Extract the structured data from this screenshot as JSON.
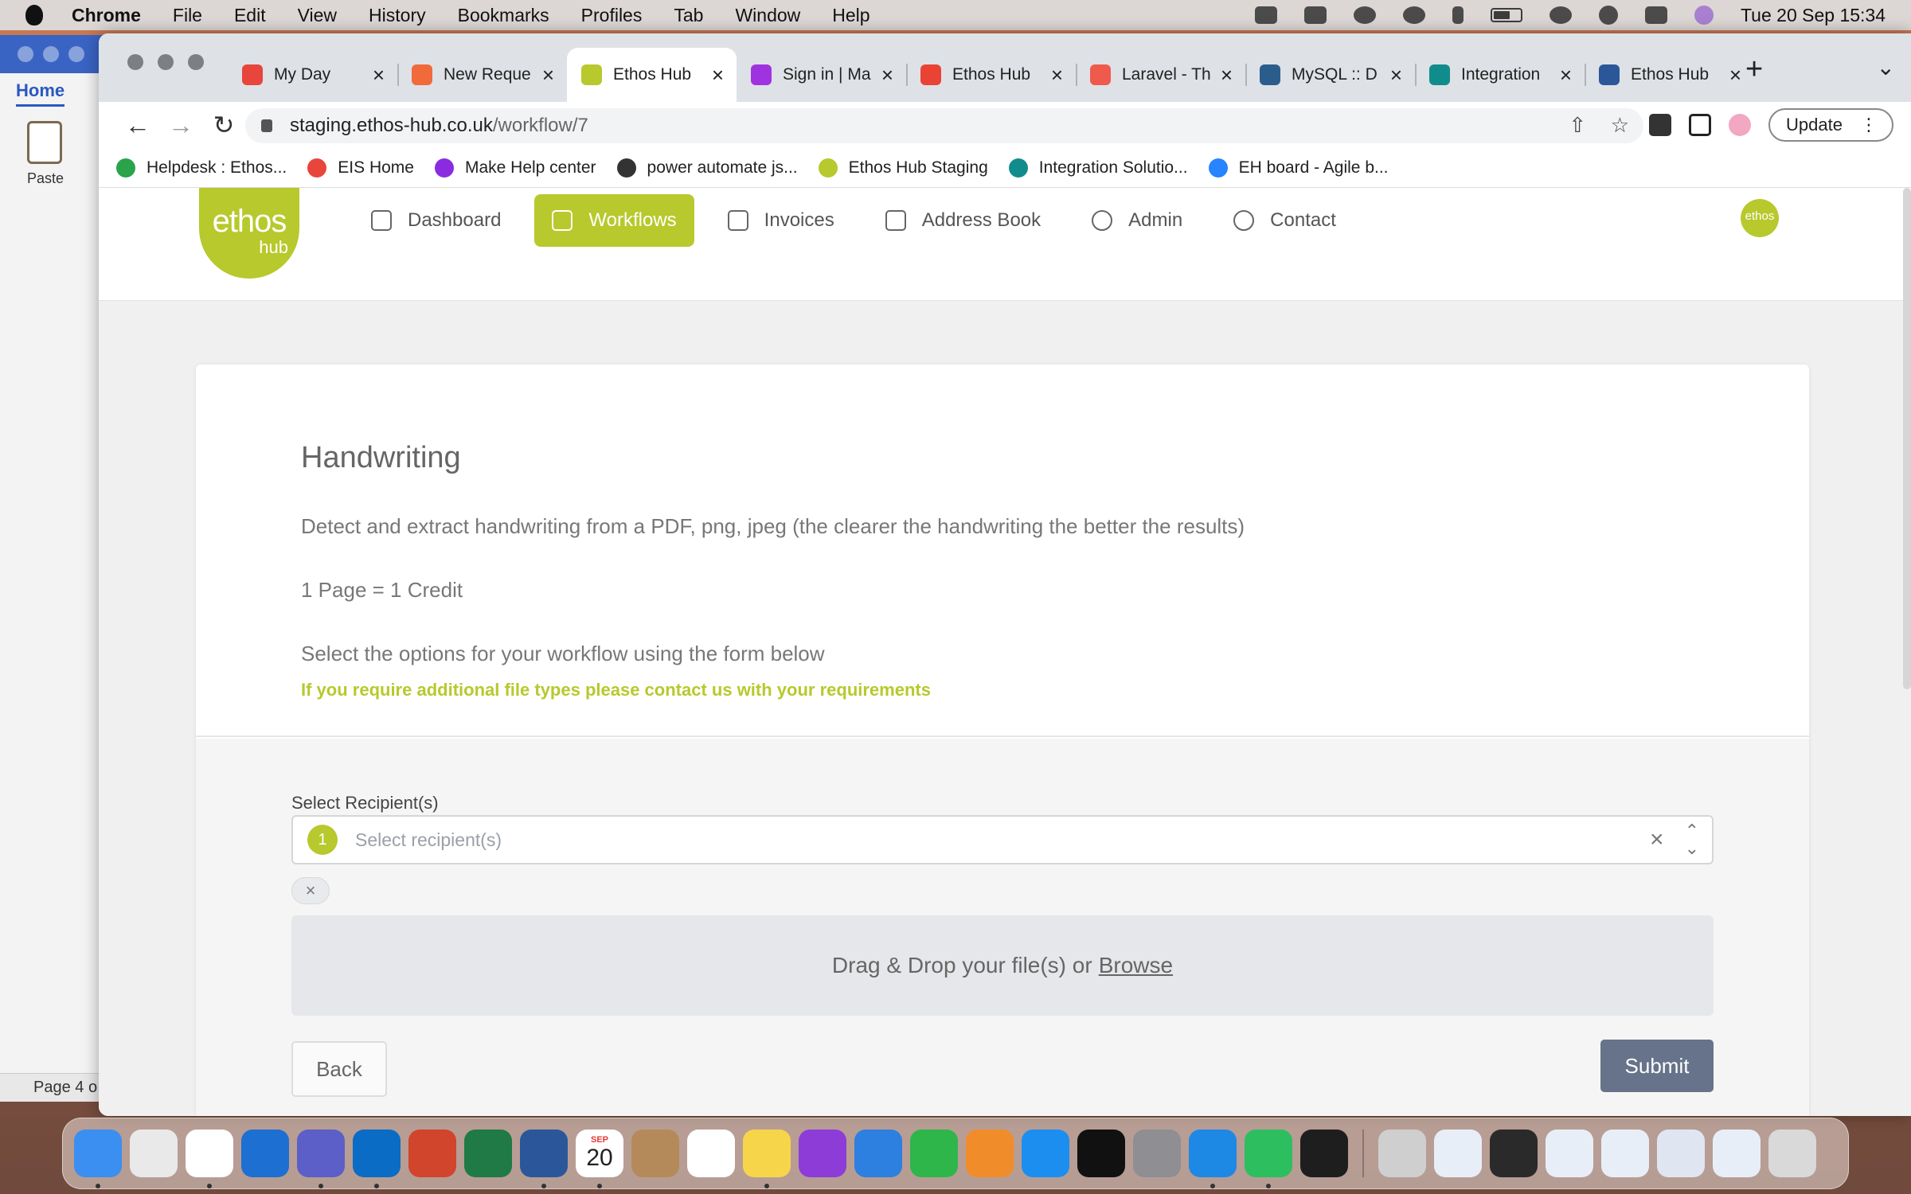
{
  "menubar": {
    "app_name": "Chrome",
    "items": [
      "File",
      "Edit",
      "View",
      "History",
      "Bookmarks",
      "Profiles",
      "Tab",
      "Window",
      "Help"
    ],
    "datetime": "Tue 20 Sep  15:34"
  },
  "word": {
    "tab_home": "Home",
    "paste_label": "Paste",
    "status": "Page 4 o"
  },
  "browser": {
    "tabs": [
      {
        "title": "My Day",
        "favicon_color": "#e8453c"
      },
      {
        "title": "New Reque",
        "favicon_color": "#f06a3a"
      },
      {
        "title": "Ethos Hub",
        "favicon_color": "#b7c92c"
      },
      {
        "title": "Sign in | Ma",
        "favicon_color": "#a033e0"
      },
      {
        "title": "Ethos Hub",
        "favicon_color": "#ea4335"
      },
      {
        "title": "Laravel - Th",
        "favicon_color": "#ef5a4c"
      },
      {
        "title": "MySQL :: D",
        "favicon_color": "#2b5d8c"
      },
      {
        "title": "Integration",
        "favicon_color": "#118c8c"
      },
      {
        "title": "Ethos Hub",
        "favicon_color": "#2b579a"
      }
    ],
    "active_tab_index": 2,
    "url_host": "staging.ethos-hub.co.uk",
    "url_path": "/workflow/7",
    "update_label": "Update",
    "bookmarks": [
      {
        "label": "Helpdesk : Ethos...",
        "color": "#2aa34a"
      },
      {
        "label": "EIS Home",
        "color": "#e8453c"
      },
      {
        "label": "Make Help center",
        "color": "#8a2be2"
      },
      {
        "label": "power automate js...",
        "color": "#333333"
      },
      {
        "label": "Ethos Hub Staging",
        "color": "#b7c92c"
      },
      {
        "label": "Integration Solutio...",
        "color": "#118c8c"
      },
      {
        "label": "EH board - Agile b...",
        "color": "#2684ff"
      }
    ]
  },
  "app": {
    "logo_text": "ethos",
    "logo_subtext": "hub",
    "avatar_text": "ethos",
    "accent_color": "#b7c92c",
    "nav": [
      {
        "label": "Dashboard",
        "icon": "bar-chart-icon",
        "active": false
      },
      {
        "label": "Workflows",
        "icon": "cube-icon",
        "active": true
      },
      {
        "label": "Invoices",
        "icon": "invoice-icon",
        "active": false
      },
      {
        "label": "Address Book",
        "icon": "book-icon",
        "active": false
      },
      {
        "label": "Admin",
        "icon": "gear-icon",
        "active": false
      },
      {
        "label": "Contact",
        "icon": "lifebuoy-icon",
        "active": false
      }
    ]
  },
  "workflow": {
    "title": "Handwriting",
    "description": "Detect and extract handwriting from a PDF, png, jpeg (the clearer the handwriting the better the results)",
    "credit": "1 Page = 1 Credit",
    "instructions": "Select the options for your workflow using the form below",
    "note": "If you require additional file types please contact us with your requirements",
    "recipient_label": "Select Recipient(s)",
    "recipient_count": "1",
    "recipient_placeholder": "Select recipient(s)",
    "dropzone_text": "Drag & Drop your file(s) or",
    "browse_label": "Browse",
    "back_label": "Back",
    "submit_label": "Submit"
  },
  "dock": {
    "calendar_month": "SEP",
    "calendar_day": "20",
    "apps": [
      {
        "name": "finder-icon",
        "color": "#3b8ff0"
      },
      {
        "name": "launchpad-icon",
        "color": "#e9e9e9"
      },
      {
        "name": "chrome-icon",
        "color": "#ffffff"
      },
      {
        "name": "onedrive-icon",
        "color": "#1d6fd1"
      },
      {
        "name": "teams-icon",
        "color": "#5b5fc7"
      },
      {
        "name": "outlook-icon",
        "color": "#0a6cc4"
      },
      {
        "name": "powerpoint-icon",
        "color": "#d0452b"
      },
      {
        "name": "excel-icon",
        "color": "#1f7a45"
      },
      {
        "name": "word-icon",
        "color": "#2b579a"
      },
      {
        "name": "calendar-icon",
        "color": "#ffffff"
      },
      {
        "name": "contacts-icon",
        "color": "#b58a5a"
      },
      {
        "name": "reminders-icon",
        "color": "#ffffff"
      },
      {
        "name": "notes-icon",
        "color": "#f7d54a"
      },
      {
        "name": "podcasts-icon",
        "color": "#8e3cd8"
      },
      {
        "name": "keynote-icon",
        "color": "#2d7fe0"
      },
      {
        "name": "numbers-icon",
        "color": "#2eb64a"
      },
      {
        "name": "pages-icon",
        "color": "#f08d2a"
      },
      {
        "name": "app-store-icon",
        "color": "#1c8ef0"
      },
      {
        "name": "phpstorm-icon",
        "color": "#111111"
      },
      {
        "name": "system-preferences-icon",
        "color": "#8e8e93"
      },
      {
        "name": "safari-icon",
        "color": "#1e88e5"
      },
      {
        "name": "evernote-icon",
        "color": "#2dbe60"
      },
      {
        "name": "terminal-icon",
        "color": "#1e1e1e"
      },
      {
        "name": "preview-icon",
        "color": "#cfcfcf"
      },
      {
        "name": "window-thumb-1-icon",
        "color": "#e8eef7"
      },
      {
        "name": "window-thumb-2-icon",
        "color": "#2a2a2a"
      },
      {
        "name": "window-thumb-3-icon",
        "color": "#e8eef7"
      },
      {
        "name": "window-thumb-4-icon",
        "color": "#e8eef7"
      },
      {
        "name": "window-thumb-5-icon",
        "color": "#dfe6f2"
      },
      {
        "name": "window-thumb-6-icon",
        "color": "#e8eef7"
      },
      {
        "name": "trash-icon",
        "color": "#d9d9d9"
      }
    ]
  }
}
